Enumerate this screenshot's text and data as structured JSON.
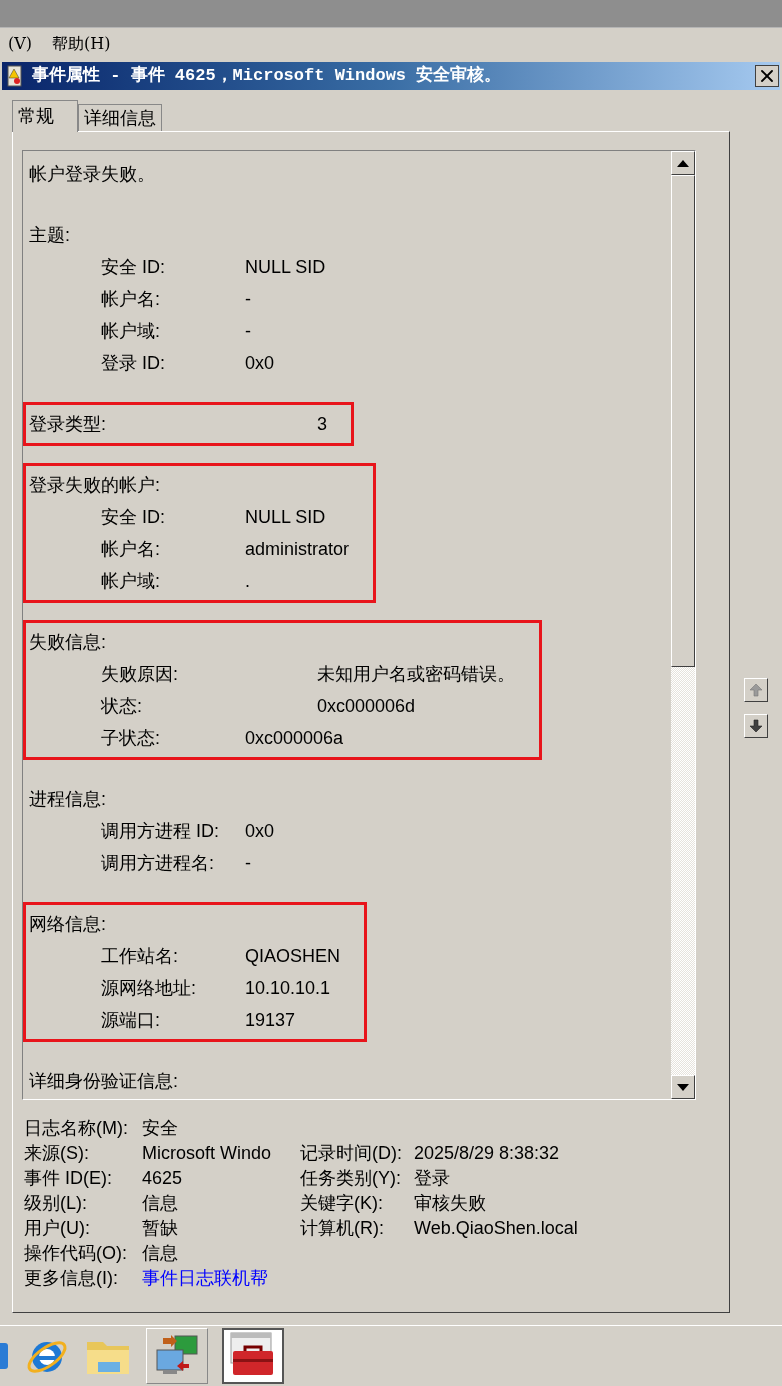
{
  "menu_bar": {
    "items": [
      "(V)",
      "帮助(H)"
    ]
  },
  "window": {
    "title": "事件属性 - 事件 4625，Microsoft Windows 安全审核。"
  },
  "tabs": [
    {
      "label": "常规",
      "selected": true
    },
    {
      "label": "详细信息",
      "selected": false
    }
  ],
  "description": {
    "sections": [
      {
        "heading": "帐户登录失败。",
        "highlighted": false
      },
      {
        "heading": "主题:",
        "highlighted": false,
        "fields": [
          {
            "label": "安全 ID:",
            "value": "NULL SID",
            "kind": "normal"
          },
          {
            "label": "帐户名:",
            "value": "-",
            "kind": "normal"
          },
          {
            "label": "帐户域:",
            "value": "-",
            "kind": "normal"
          },
          {
            "label": "登录 ID:",
            "value": "0x0",
            "kind": "normal"
          }
        ]
      },
      {
        "heading": "登录类型:",
        "value": "3",
        "highlighted": true
      },
      {
        "heading": "登录失败的帐户:",
        "highlighted": true,
        "fields": [
          {
            "label": "安全 ID:",
            "value": "NULL SID",
            "kind": "normal"
          },
          {
            "label": "帐户名:",
            "value": "administrator",
            "kind": "normal"
          },
          {
            "label": "帐户域:",
            "value": ".",
            "kind": "normal"
          }
        ]
      },
      {
        "heading": "失败信息:",
        "highlighted": true,
        "fields": [
          {
            "label": "失败原因:",
            "value": "未知用户名或密码错误。",
            "kind": "wide"
          },
          {
            "label": "状态:",
            "value": "0xc000006d",
            "kind": "wide"
          },
          {
            "label": "子状态:",
            "value": "0xc000006a",
            "kind": "normal"
          }
        ]
      },
      {
        "heading": "进程信息:",
        "highlighted": false,
        "fields": [
          {
            "label": "调用方进程 ID:",
            "value": "0x0",
            "kind": "normal"
          },
          {
            "label": "调用方进程名:",
            "value": "-",
            "kind": "normal"
          }
        ]
      },
      {
        "heading": "网络信息:",
        "highlighted": true,
        "fields": [
          {
            "label": "工作站名:",
            "value": "QIAOSHEN",
            "kind": "normal"
          },
          {
            "label": "源网络地址:",
            "value": "10.10.10.1",
            "kind": "normal"
          },
          {
            "label": "源端口:",
            "value": "19137",
            "kind": "normal"
          }
        ]
      },
      {
        "heading": "详细身份验证信息:",
        "highlighted": false
      }
    ]
  },
  "nav_buttons": [
    {
      "kind": "up",
      "disabled": true
    },
    {
      "kind": "down",
      "disabled": false
    }
  ],
  "info": {
    "rows": [
      {
        "left": {
          "label": "日志名称(M):",
          "value": "安全"
        }
      },
      {
        "left": {
          "label": "来源(S):",
          "value": "Microsoft Windo"
        },
        "right": {
          "label": "记录时间(D):",
          "value": "2025/8/29 8:38:32"
        }
      },
      {
        "left": {
          "label": "事件 ID(E):",
          "value": "4625"
        },
        "right": {
          "label": "任务类别(Y):",
          "value": "登录"
        }
      },
      {
        "left": {
          "label": "级别(L):",
          "value": "信息"
        },
        "right": {
          "label": "关键字(K):",
          "value": "审核失败"
        }
      },
      {
        "left": {
          "label": "用户(U):",
          "value": "暂缺"
        },
        "right": {
          "label": "计算机(R):",
          "value": "Web.QiaoShen.local"
        }
      },
      {
        "left": {
          "label": "操作代码(O):",
          "value": "信息"
        }
      },
      {
        "left": {
          "label": "更多信息(I):",
          "value": "事件日志联机帮",
          "kind": "link"
        }
      }
    ]
  },
  "taskbar": {
    "items": [
      {
        "kind": "partial",
        "selected": false
      },
      {
        "kind": "browser",
        "selected": false
      },
      {
        "kind": "folder",
        "selected": false
      },
      {
        "kind": "network",
        "selected": false
      },
      {
        "kind": "toolbox",
        "selected": true
      }
    ]
  }
}
